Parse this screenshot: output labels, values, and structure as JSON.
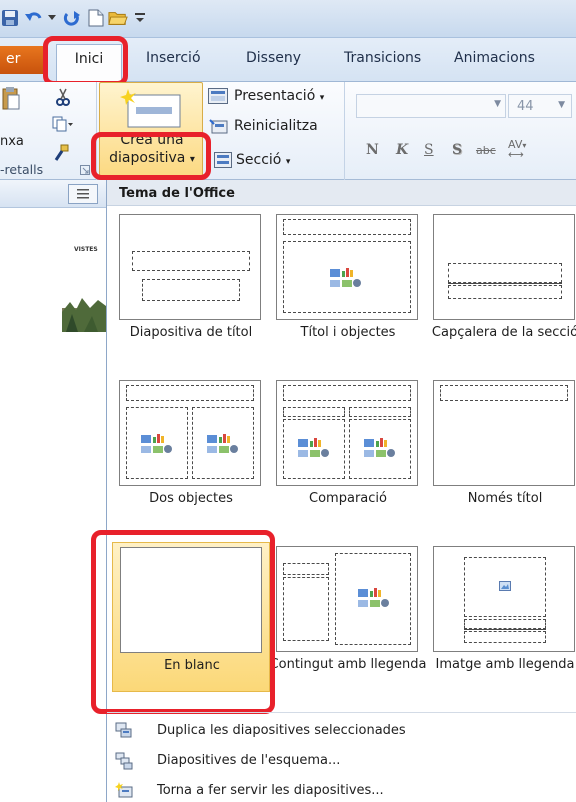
{
  "quick_access": {
    "icons": [
      "save-icon",
      "undo-icon",
      "redo-icon",
      "new-document-icon",
      "open-folder-icon",
      "customize-toolbar-icon"
    ]
  },
  "tabs": {
    "file": "er",
    "home": "Inici",
    "insert": "Inserció",
    "design": "Disseny",
    "transitions": "Transicions",
    "animations": "Animacions"
  },
  "ribbon": {
    "paste_label": "nxa",
    "clipboard_group": "-retalls",
    "new_slide_line1": "Crea una",
    "new_slide_line2": "diapositiva",
    "layout_label": "Presentació",
    "reset_label": "Reinicialitza",
    "section_label": "Secció",
    "font_size": "44",
    "format_buttons": [
      "N",
      "K",
      "S",
      "S",
      "abc",
      "AV"
    ]
  },
  "left_pane": {
    "slide_thumb_text": "VISTES"
  },
  "gallery": {
    "header": "Tema de l'Office",
    "layouts": [
      {
        "label": "Diapositiva de títol",
        "selected": false
      },
      {
        "label": "Títol i objectes",
        "selected": false
      },
      {
        "label": "Capçalera de la secció",
        "selected": false
      },
      {
        "label": "Dos objectes",
        "selected": false
      },
      {
        "label": "Comparació",
        "selected": false
      },
      {
        "label": "Només títol",
        "selected": false
      },
      {
        "label": "En blanc",
        "selected": true
      },
      {
        "label": "Contingut amb llegenda",
        "selected": false
      },
      {
        "label": "Imatge amb llegenda",
        "selected": false
      }
    ],
    "menu": [
      {
        "label": "Duplica les diapositives seleccionades",
        "icon": "duplicate-slides-icon"
      },
      {
        "label": "Diapositives de l'esquema...",
        "icon": "outline-slides-icon"
      },
      {
        "label": "Torna a fer servir les diapositives...",
        "icon": "reuse-slides-icon"
      }
    ]
  },
  "colors": {
    "highlight": "#e8212b",
    "selected_fill": "#fbd878",
    "ribbon_blue": "#d5e3f3",
    "file_tab": "#c8520c"
  }
}
